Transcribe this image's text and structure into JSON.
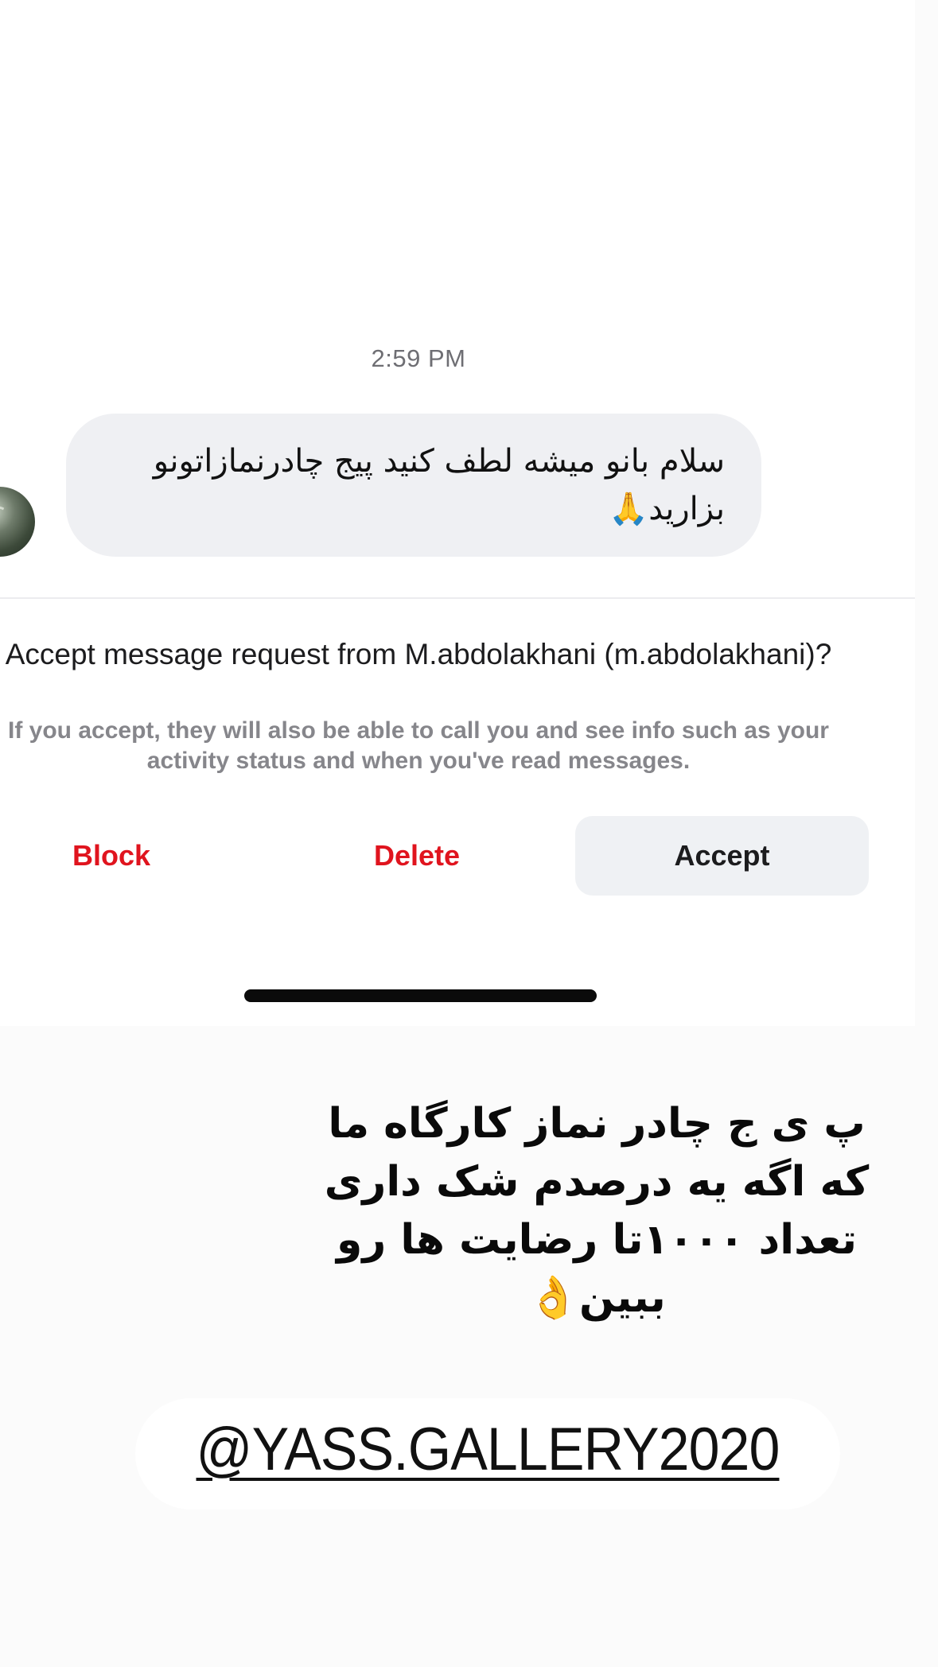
{
  "conversation": {
    "timestamp": "2:59 PM",
    "message": {
      "text": "سلام بانو میشه لطف کنید پیج چادرنمازاتونو بزارید🙏"
    }
  },
  "request_prompt": {
    "title": "Accept message request from M.abdolakhani (m.abdolakhani)?",
    "info": "If you accept, they will also be able to call you and see info such as your activity status and when you've read messages.",
    "actions": {
      "block_label": "Block",
      "delete_label": "Delete",
      "accept_label": "Accept"
    }
  },
  "story_overlay": {
    "caption": "پ ی ج چادر نماز کارگاه ما که اگه یه درصدم شک داری تعداد ۱۰۰۰تا رضایت ها رو ببین👌",
    "mention": "@YASS.GALLERY2020"
  },
  "colors": {
    "destructive": "#e0141e",
    "bubble_bg": "#eff0f3",
    "accept_bg": "#eff1f4",
    "secondary_text": "#86868b"
  }
}
